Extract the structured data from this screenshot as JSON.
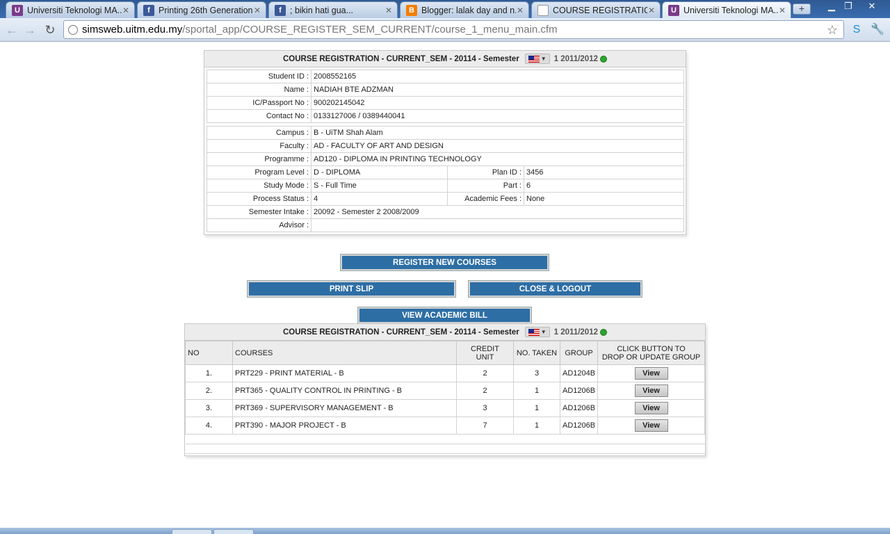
{
  "browser": {
    "tabs": [
      {
        "title": "Universiti Teknologi MA...",
        "icon": "uitm-icon",
        "active": false
      },
      {
        "title": "Printing 26th Generation",
        "icon": "facebook-icon",
        "active": false
      },
      {
        "title": "; bikin hati gua...",
        "icon": "facebook-icon",
        "active": false
      },
      {
        "title": "Blogger: lalak day and n...",
        "icon": "blogger-icon",
        "active": false
      },
      {
        "title": "COURSE REGISTRATION...",
        "icon": "page-icon",
        "active": false
      },
      {
        "title": "Universiti Teknologi MA...",
        "icon": "uitm-icon",
        "active": true
      }
    ],
    "url_host": "simsweb.uitm.edu.my",
    "url_path": "/sportal_app/COURSE_REGISTER_SEM_CURRENT/course_1_menu_main.cfm"
  },
  "header": {
    "title": "COURSE REGISTRATION - CURRENT_SEM - 20114 - Semester",
    "semester": "1 2011/2012"
  },
  "student": {
    "rows": [
      {
        "label": "Student ID :",
        "value": "2008552165"
      },
      {
        "label": "Name :",
        "value": "NADIAH BTE ADZMAN"
      },
      {
        "label": "IC/Passport No :",
        "value": "900202145042"
      },
      {
        "label": "Contact No :",
        "value": "0133127006 / 0389440041"
      }
    ]
  },
  "academic": {
    "campus": {
      "label": "Campus :",
      "value": "B - UiTM Shah Alam"
    },
    "faculty": {
      "label": "Faculty :",
      "value": "AD - FACULTY OF ART AND DESIGN"
    },
    "programme": {
      "label": "Programme :",
      "value": "AD120 - DIPLOMA IN PRINTING TECHNOLOGY"
    },
    "program_level": {
      "label": "Program Level :",
      "value": "D - DIPLOMA"
    },
    "plan_id": {
      "label": "Plan ID :",
      "value": "3456"
    },
    "study_mode": {
      "label": "Study Mode :",
      "value": "S - Full Time"
    },
    "part": {
      "label": "Part :",
      "value": "6"
    },
    "process_status": {
      "label": "Process Status :",
      "value": "4"
    },
    "academic_fees": {
      "label": "Academic Fees :",
      "value": "None"
    },
    "semester_intake": {
      "label": "Semester Intake :",
      "value": "20092 - Semester 2 2008/2009"
    },
    "advisor": {
      "label": "Advisor :",
      "value": ""
    }
  },
  "buttons": {
    "register": "REGISTER NEW COURSES",
    "print": "PRINT SLIP",
    "logout": "CLOSE & LOGOUT",
    "bill": "VIEW ACADEMIC BILL"
  },
  "courses": {
    "title": "COURSE REGISTRATION - CURRENT_SEM - 20114 - Semester",
    "semester": "1 2011/2012",
    "headers": {
      "no": "NO",
      "course": "COURSES",
      "credit_1": "CREDIT",
      "credit_2": "UNIT",
      "taken": "NO. TAKEN",
      "group": "GROUP",
      "action_1": "CLICK BUTTON TO",
      "action_2": "DROP OR UPDATE GROUP"
    },
    "rows": [
      {
        "no": "1.",
        "course": "PRT229 - PRINT MATERIAL - B",
        "credit": "2",
        "taken": "3",
        "group": "AD1204B",
        "action": "View"
      },
      {
        "no": "2.",
        "course": "PRT365 - QUALITY CONTROL IN PRINTING - B",
        "credit": "2",
        "taken": "1",
        "group": "AD1206B",
        "action": "View"
      },
      {
        "no": "3.",
        "course": "PRT369 - SUPERVISORY MANAGEMENT - B",
        "credit": "3",
        "taken": "1",
        "group": "AD1206B",
        "action": "View"
      },
      {
        "no": "4.",
        "course": "PRT390 - MAJOR PROJECT - B",
        "credit": "7",
        "taken": "1",
        "group": "AD1206B",
        "action": "View"
      }
    ]
  },
  "colors": {
    "button_bg": "#2d6ea5",
    "header_bg": "#ececec",
    "ok_dot": "#2fa32f"
  }
}
